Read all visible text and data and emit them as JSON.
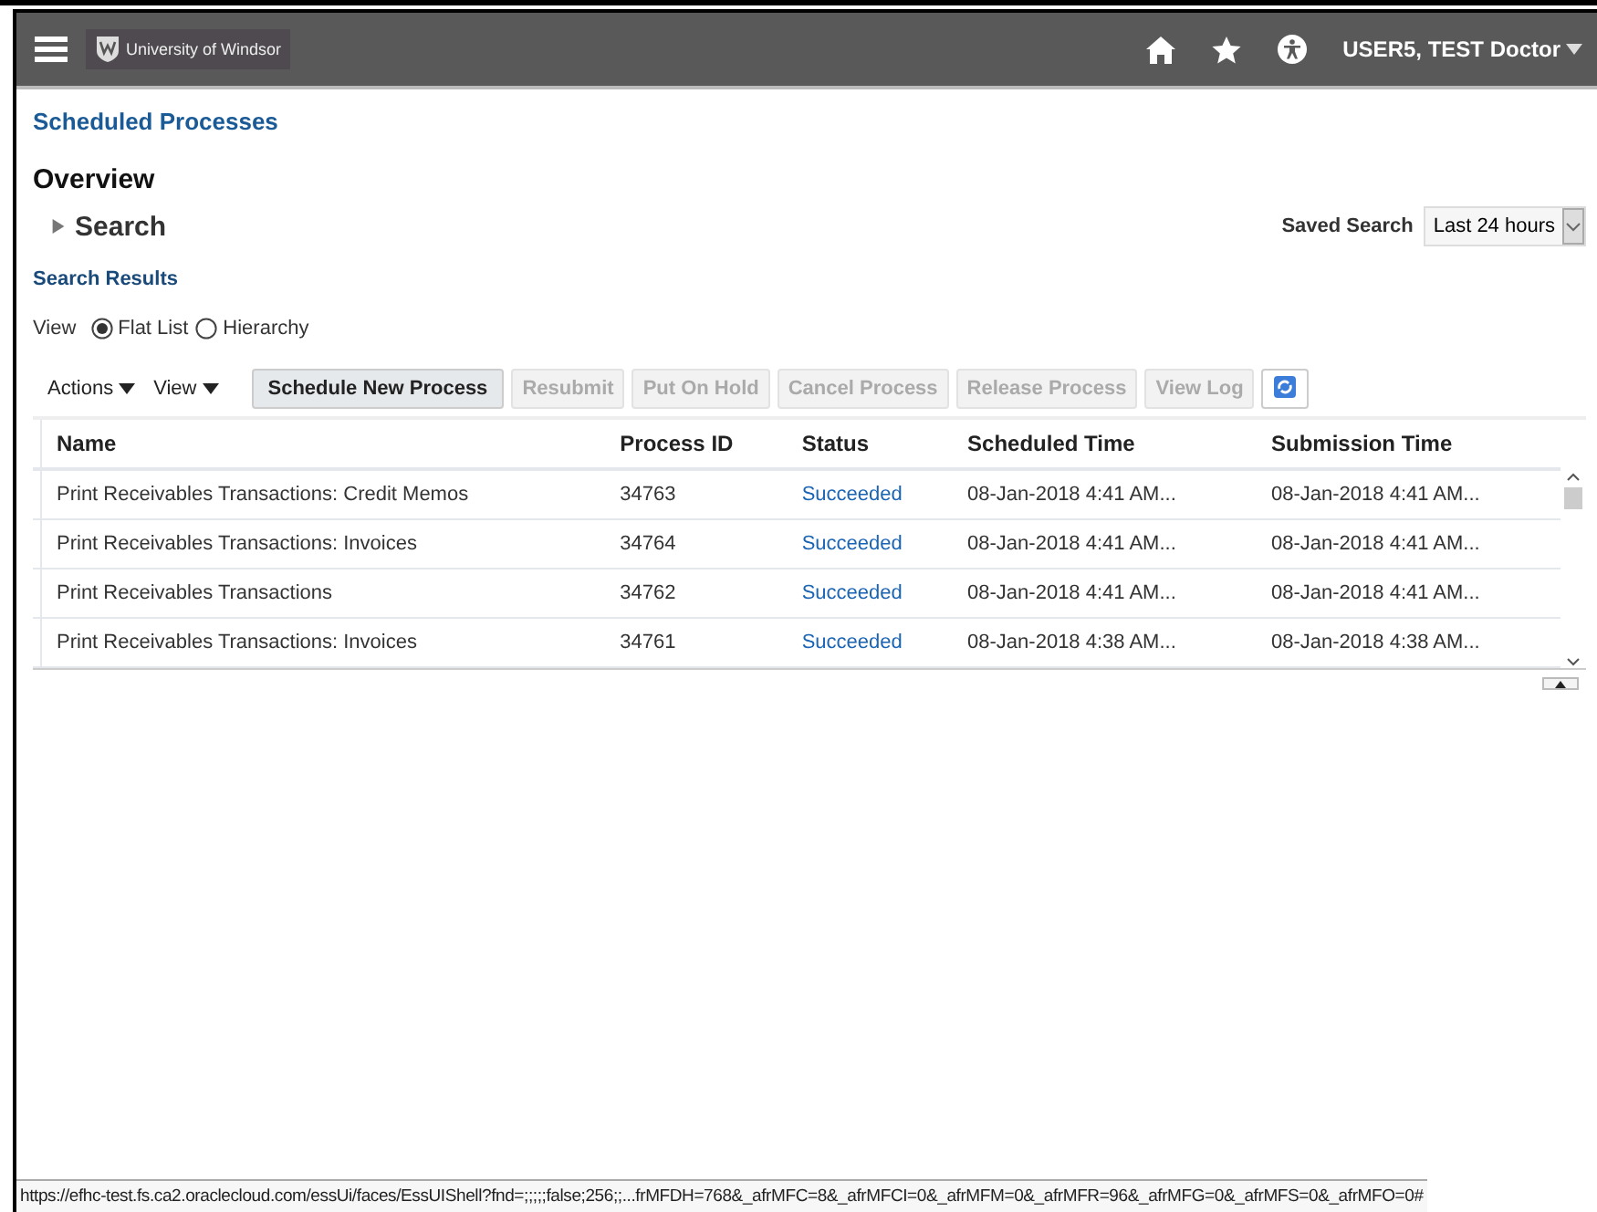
{
  "header": {
    "logo_text": "University of Windsor",
    "user": "USER5, TEST Doctor"
  },
  "breadcrumb": "Scheduled Processes",
  "page_title": "Overview",
  "search": {
    "label": "Search",
    "expanded": false,
    "saved_search_label": "Saved Search",
    "saved_search_value": "Last 24 hours"
  },
  "results_title": "Search Results",
  "view": {
    "label": "View",
    "options": [
      {
        "label": "Flat List",
        "selected": true
      },
      {
        "label": "Hierarchy",
        "selected": false
      }
    ]
  },
  "toolbar": {
    "menus": [
      "Actions",
      "View"
    ],
    "buttons": [
      {
        "label": "Schedule New Process",
        "disabled": false
      },
      {
        "label": "Resubmit",
        "disabled": true
      },
      {
        "label": "Put On Hold",
        "disabled": true
      },
      {
        "label": "Cancel Process",
        "disabled": true
      },
      {
        "label": "Release Process",
        "disabled": true
      },
      {
        "label": "View Log",
        "disabled": true
      }
    ]
  },
  "table": {
    "columns": [
      "Name",
      "Process ID",
      "Status",
      "Scheduled Time",
      "Submission Time"
    ],
    "rows": [
      {
        "name": "Print Receivables Transactions: Credit Memos",
        "process_id": "34763",
        "status": "Succeeded",
        "scheduled_time": "08-Jan-2018 4:41 AM...",
        "submission_time": "08-Jan-2018 4:41 AM..."
      },
      {
        "name": "Print Receivables Transactions: Invoices",
        "process_id": "34764",
        "status": "Succeeded",
        "scheduled_time": "08-Jan-2018 4:41 AM...",
        "submission_time": "08-Jan-2018 4:41 AM..."
      },
      {
        "name": "Print Receivables Transactions",
        "process_id": "34762",
        "status": "Succeeded",
        "scheduled_time": "08-Jan-2018 4:41 AM...",
        "submission_time": "08-Jan-2018 4:41 AM..."
      },
      {
        "name": "Print Receivables Transactions: Invoices",
        "process_id": "34761",
        "status": "Succeeded",
        "scheduled_time": "08-Jan-2018 4:38 AM...",
        "submission_time": "08-Jan-2018 4:38 AM..."
      }
    ]
  },
  "status_bar": "https://efhc-test.fs.ca2.oraclecloud.com/essUi/faces/EssUIShell?fnd=;;;;;false;256;;...frMFDH=768&_afrMFC=8&_afrMFCI=0&_afrMFM=0&_afrMFR=96&_afrMFG=0&_afrMFS=0&_afrMFO=0#"
}
